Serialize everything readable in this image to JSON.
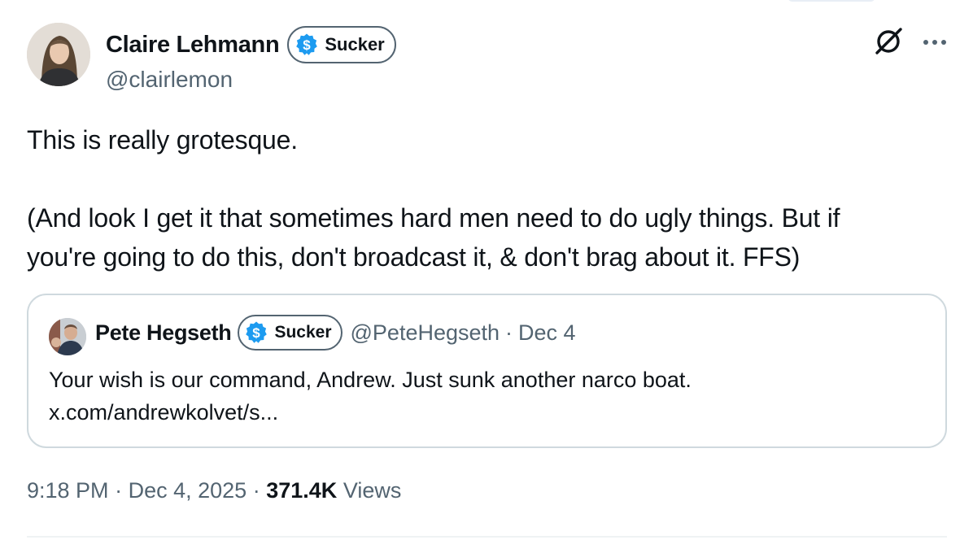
{
  "author": {
    "display_name": "Claire Lehmann",
    "handle": "@clairlemon",
    "badge_label": "Sucker"
  },
  "tweet": {
    "line1": "This is really grotesque.",
    "line2": "(And look I get it that sometimes hard men need to do ugly things. But if",
    "line3": "you're going to do this, don't broadcast it, & don't brag about it. FFS)"
  },
  "quote": {
    "display_name": "Pete Hegseth",
    "badge_label": "Sucker",
    "handle": "@PeteHegseth",
    "separator": "·",
    "date": "Dec 4",
    "line1": "Your wish is our command, Andrew. Just sunk another narco boat.",
    "line2": "x.com/andrewkolvet/s..."
  },
  "meta": {
    "time": "9:18 PM",
    "separator": "·",
    "date": "Dec 4, 2025",
    "views_count": "371.4K",
    "views_label": "Views"
  },
  "icons": {
    "badge": "dollar-badge-icon",
    "grok": "grok-icon",
    "more": "more-icon"
  },
  "colors": {
    "text": "#0f1419",
    "secondary": "#536471",
    "border": "#cfd9de",
    "badge_blue": "#1d9bf0"
  }
}
